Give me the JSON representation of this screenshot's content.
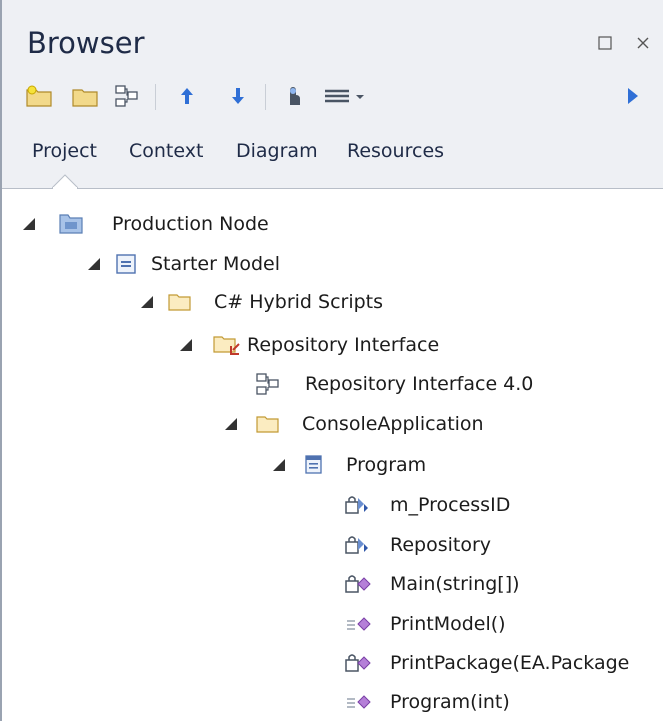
{
  "window": {
    "title": "Browser",
    "restore_glyph": "□",
    "close_glyph": "×"
  },
  "toolbar": {
    "icons": [
      "new-folder-icon",
      "open-folder-icon",
      "diagram-icon",
      "move-up-icon",
      "move-down-icon",
      "locate-icon",
      "menu-icon",
      "more-icon"
    ]
  },
  "tabs": [
    "Project",
    "Context",
    "Diagram",
    "Resources"
  ],
  "active_tab": "Project",
  "tree": [
    {
      "label": "Production Node",
      "icon": "model-root-icon",
      "expanded": true
    },
    {
      "label": "Starter Model",
      "icon": "model-icon",
      "expanded": true
    },
    {
      "label": "C# Hybrid Scripts",
      "icon": "package-folder-icon",
      "expanded": true
    },
    {
      "label": "Repository Interface",
      "icon": "package-folder-linked-icon",
      "expanded": true
    },
    {
      "label": "Repository Interface 4.0",
      "icon": "diagram-icon",
      "expanded": null
    },
    {
      "label": "ConsoleApplication",
      "icon": "package-folder-icon",
      "expanded": true
    },
    {
      "label": "Program",
      "icon": "class-icon",
      "expanded": true
    },
    {
      "label": "m_ProcessID",
      "icon": "private-attribute-icon",
      "expanded": null
    },
    {
      "label": "Repository",
      "icon": "attribute-icon",
      "expanded": null
    },
    {
      "label": "Main(string[])",
      "icon": "private-operation-icon",
      "expanded": null
    },
    {
      "label": "PrintModel()",
      "icon": "operation-icon",
      "expanded": null
    },
    {
      "label": "PrintPackage(EA.Package",
      "icon": "private-operation-icon",
      "expanded": null
    },
    {
      "label": "Program(int)",
      "icon": "operation-icon",
      "expanded": null
    }
  ],
  "colors": {
    "accent": "#3a7bd5",
    "folder": "#f2d98a",
    "purple": "#9b59b6"
  }
}
